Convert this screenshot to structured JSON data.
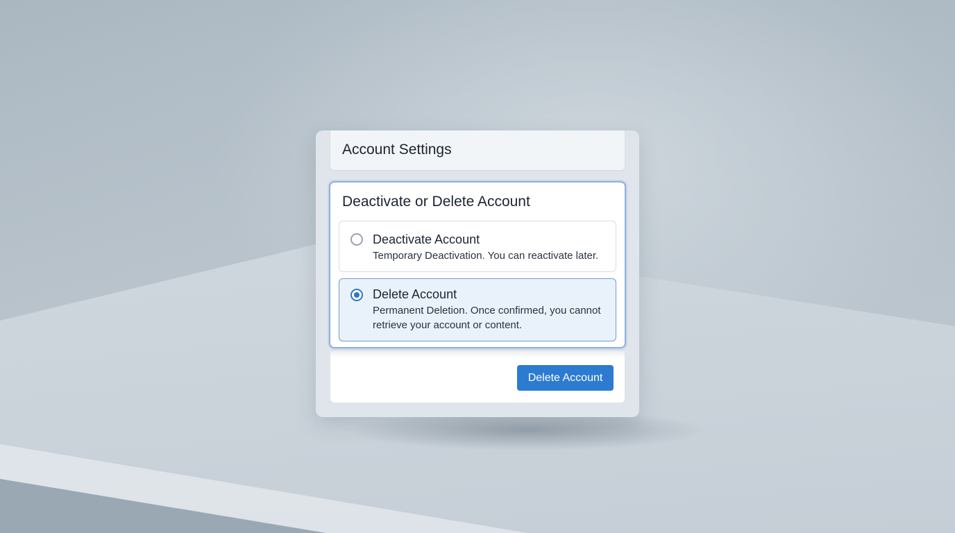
{
  "header": {
    "title": "Account Settings"
  },
  "section": {
    "title": "Deactivate or Delete Account",
    "options": [
      {
        "label": "Deactivate Account",
        "description": "Temporary Deactivation. You can reactivate later.",
        "selected": false
      },
      {
        "label": "Delete Account",
        "description": "Permanent Deletion. Once confirmed, you cannot retrieve your account or content.",
        "selected": true
      }
    ]
  },
  "footer": {
    "delete_button_label": "Delete Account"
  },
  "colors": {
    "accent": "#2c7bd1",
    "selected_background": "#e9f2fb",
    "selected_border": "#6f9cc9"
  }
}
